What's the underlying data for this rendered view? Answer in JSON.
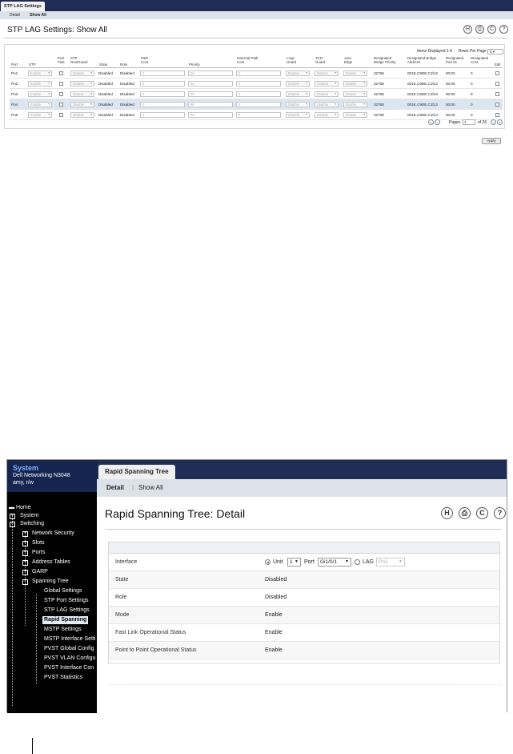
{
  "shot1": {
    "tab": "STP LAG Settings",
    "subnav": [
      "Detail",
      "Show All"
    ],
    "title": "STP LAG Settings: Show All",
    "toolbar": {
      "save": "H",
      "print": "⎙",
      "refresh": "C",
      "help": "?"
    },
    "items_displayed": "Items Displayed 1-5",
    "rows_per_page_label": "Rows Per Page",
    "rows_per_page_value": "5",
    "columns": [
      "Port",
      "STP",
      "Port Fast",
      "STP RootGuard",
      "State",
      "Role",
      "Path Cost",
      "Priority",
      "External Path Cost",
      "Loop Guard",
      "TCN Guard",
      "Auto Edge",
      "Designated Bridge Priority",
      "Designated Bridge Address",
      "Designated Port ID",
      "Designated Cost",
      "Edit"
    ],
    "rows": [
      {
        "port": "Po1",
        "stp": "Enable",
        "rootguard": "Disable",
        "state": "Disabled",
        "role": "Disabled",
        "path_cost": "0",
        "priority": "96",
        "ext_cost": "0",
        "loop": "Disable",
        "tcn": "Disable",
        "auto": "Enable",
        "dbp": "32768",
        "dba": "001E.C9DE.C1f13",
        "dpid": "00:00",
        "dcost": "0"
      },
      {
        "port": "Po2",
        "stp": "Enable",
        "rootguard": "Disable",
        "state": "Disabled",
        "role": "Disabled",
        "path_cost": "0",
        "priority": "96",
        "ext_cost": "0",
        "loop": "Disable",
        "tcn": "Disable",
        "auto": "Enable",
        "dbp": "32768",
        "dba": "001E.C9DE.C1f13",
        "dpid": "00:00",
        "dcost": "0"
      },
      {
        "port": "Po3",
        "stp": "Enable",
        "rootguard": "Disable",
        "state": "Disabled",
        "role": "Disabled",
        "path_cost": "0",
        "priority": "96",
        "ext_cost": "0",
        "loop": "Disable",
        "tcn": "Disable",
        "auto": "Enable",
        "dbp": "32768",
        "dba": "001E.C9DE.C1f13",
        "dpid": "00:00",
        "dcost": "0"
      },
      {
        "port": "Po4",
        "stp": "Enable",
        "rootguard": "Disable",
        "state": "Disabled",
        "role": "Disabled",
        "path_cost": "0",
        "priority": "96",
        "ext_cost": "0",
        "loop": "Disable",
        "tcn": "Disable",
        "auto": "Enable",
        "dbp": "32768",
        "dba": "001E.C9DE.C1f13",
        "dpid": "00:00",
        "dcost": "0"
      },
      {
        "port": "Po5",
        "stp": "Enable",
        "rootguard": "Disable",
        "state": "Disabled",
        "role": "Disabled",
        "path_cost": "0",
        "priority": "96",
        "ext_cost": "0",
        "loop": "Disable",
        "tcn": "Disable",
        "auto": "Enable",
        "dbp": "32768",
        "dba": "001E.C9DE.C1f13",
        "dpid": "00:00",
        "dcost": "0"
      }
    ],
    "pages_label": "Pages",
    "page_value": "1",
    "of_pages": "of 26",
    "apply": "Apply"
  },
  "shot2": {
    "sidebar": {
      "system": "System",
      "device": "Dell Networking N3048",
      "user": "amy, r/w",
      "tree": [
        {
          "label": "Home",
          "level": 0,
          "pm": ""
        },
        {
          "label": "System",
          "level": 0,
          "pm": "+"
        },
        {
          "label": "Switching",
          "level": 0,
          "pm": "−"
        },
        {
          "label": "Network Security",
          "level": 1,
          "pm": "+"
        },
        {
          "label": "Slots",
          "level": 1,
          "pm": "+"
        },
        {
          "label": "Ports",
          "level": 1,
          "pm": "+"
        },
        {
          "label": "Address Tables",
          "level": 1,
          "pm": "+"
        },
        {
          "label": "GARP",
          "level": 1,
          "pm": "+"
        },
        {
          "label": "Spanning Tree",
          "level": 1,
          "pm": "−"
        },
        {
          "label": "Global Settings",
          "level": 2,
          "pm": ""
        },
        {
          "label": "STP Port Settings",
          "level": 2,
          "pm": ""
        },
        {
          "label": "STP LAG Settings",
          "level": 2,
          "pm": ""
        },
        {
          "label": "Rapid Spanning",
          "level": 2,
          "pm": "",
          "active": true
        },
        {
          "label": "MSTP Settings",
          "level": 2,
          "pm": ""
        },
        {
          "label": "MSTP Interface Setti",
          "level": 2,
          "pm": ""
        },
        {
          "label": "PVST Global Config",
          "level": 2,
          "pm": ""
        },
        {
          "label": "PVST VLAN Configu",
          "level": 2,
          "pm": ""
        },
        {
          "label": "PVST Interface Con",
          "level": 2,
          "pm": ""
        },
        {
          "label": "PVST Statistics",
          "level": 2,
          "pm": ""
        }
      ]
    },
    "tab": "Rapid Spanning Tree",
    "subnav": [
      "Detail",
      "Show All"
    ],
    "title": "Rapid Spanning Tree: Detail",
    "toolbar": {
      "save": "H",
      "print": "⎙",
      "refresh": "C",
      "help": "?"
    },
    "interface": {
      "label": "Interface",
      "unit_label": "Unit",
      "unit_value": "1",
      "port_label": "Port",
      "port_value": "Gi1/0/1",
      "lag_label": "LAG",
      "lag_value": "Po1"
    },
    "fields": [
      {
        "label": "State",
        "value": "Disabled"
      },
      {
        "label": "Role",
        "value": "Disabled"
      },
      {
        "label": "Mode",
        "value": "Enable"
      },
      {
        "label": "Fast Link Operational Status",
        "value": "Enable"
      },
      {
        "label": "Point to Point Operational Status",
        "value": "Enable"
      }
    ]
  }
}
